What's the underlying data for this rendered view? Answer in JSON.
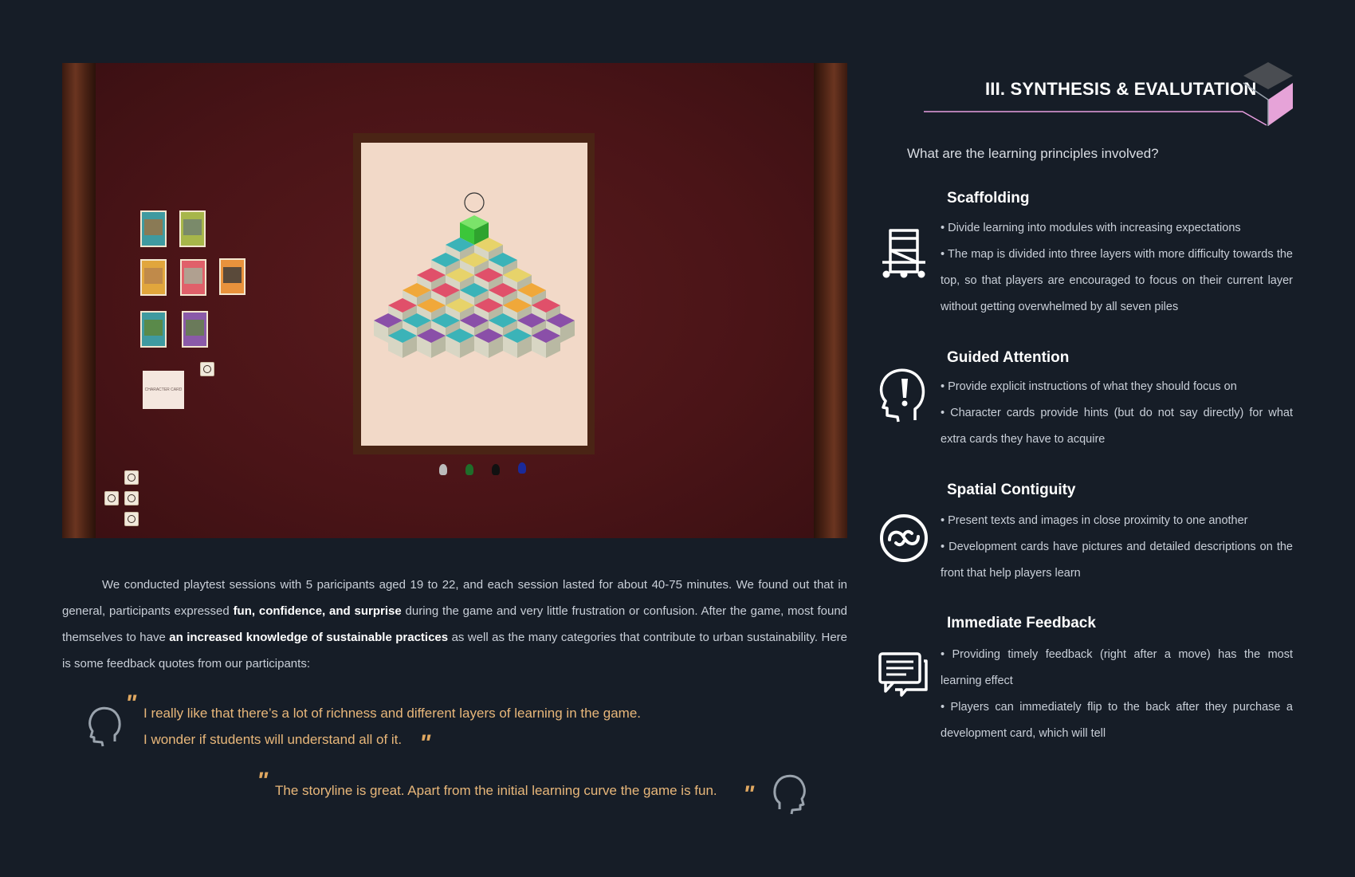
{
  "board": {
    "character_card_label": "CHARACTER CARD"
  },
  "section": {
    "title": "III. SYNTHESIS & EVALUTATION",
    "question": "What are the learning principles involved?",
    "accent_color": "#e89ee0"
  },
  "intro": {
    "p1": "We conducted playtest sessions with 5 paricipants aged 19 to 22, and each session lasted for about 40-75 minutes. We found out that in general, participants expressed ",
    "b1": "fun, confidence, and surprise",
    "p2": " during the game and very little frustration or confusion. After the game, most found themselves to have ",
    "b2": "an increased knowledge of sustainable practices",
    "p3": " as well as the many categories that contribute to urban sustainability. Here is some feedback quotes from our participants:"
  },
  "quotes": [
    {
      "line1": "I really like that there’s a lot of richness and different layers of learning in the game.",
      "line2": "I wonder if students will understand all of it."
    },
    {
      "line1": "The storyline is great. Apart from the initial learning curve the game is fun."
    }
  ],
  "principles": [
    {
      "title": "Scaffolding",
      "icon": "scaffold-icon",
      "bullets": [
        "• Divide learning into modules with increasing expectations",
        "• The map is divided into three layers with more difficulty towards the top, so that players are encouraged to focus on their current layer without getting overwhelmed by all seven piles"
      ]
    },
    {
      "title": "Guided Attention",
      "icon": "head-exclamation-icon",
      "bullets": [
        "• Provide explicit instructions of what they should focus on",
        "• Character cards provide hints (but do not say directly) for what extra cards they have to acquire"
      ]
    },
    {
      "title": "Spatial Contiguity",
      "icon": "link-circle-icon",
      "bullets": [
        "• Present texts and images in close proximity to one another",
        "• Development cards have pictures and detailed descriptions on the front that help players learn"
      ]
    },
    {
      "title": "Immediate Feedback",
      "icon": "chat-bubble-icon",
      "bullets": [
        "• Providing timely feedback (right after a move) has the most learning effect",
        "• Players can immediately flip to the back after they purchase a development card, which will tell"
      ]
    }
  ]
}
